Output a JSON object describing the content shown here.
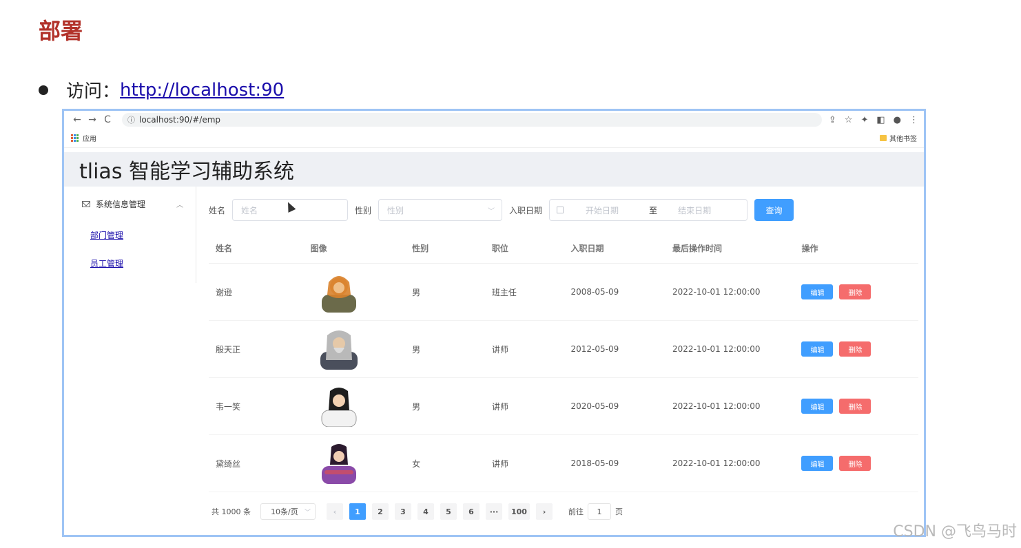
{
  "slide": {
    "title": "部署",
    "bullet_prefix": "访问：",
    "bullet_link": "http://localhost:90"
  },
  "browser": {
    "nav": {
      "back": "←",
      "forward": "→",
      "reload": "C"
    },
    "address": "localhost:90/#/emp",
    "bookmarks": {
      "apps_label": "应用",
      "other_label": "其他书签"
    }
  },
  "app": {
    "header_title": "tlias 智能学习辅助系统",
    "sidebar": {
      "group_label": "系统信息管理",
      "items": [
        {
          "label": "部门管理"
        },
        {
          "label": "员工管理"
        }
      ]
    },
    "filters": {
      "name_label": "姓名",
      "name_placeholder": "姓名",
      "gender_label": "性别",
      "gender_placeholder": "性别",
      "entry_label": "入职日期",
      "start_placeholder": "开始日期",
      "range_separator": "至",
      "end_placeholder": "结束日期",
      "search_button": "查询"
    },
    "table": {
      "columns": [
        "姓名",
        "图像",
        "性别",
        "职位",
        "入职日期",
        "最后操作时间",
        "操作"
      ],
      "rows": [
        {
          "name": "谢逊",
          "gender": "男",
          "job": "班主任",
          "entry_date": "2008-05-09",
          "update_time": "2022-10-01 12:00:00"
        },
        {
          "name": "殷天正",
          "gender": "男",
          "job": "讲师",
          "entry_date": "2012-05-09",
          "update_time": "2022-10-01 12:00:00"
        },
        {
          "name": "韦一笑",
          "gender": "男",
          "job": "讲师",
          "entry_date": "2020-05-09",
          "update_time": "2022-10-01 12:00:00"
        },
        {
          "name": "黛绮丝",
          "gender": "女",
          "job": "讲师",
          "entry_date": "2018-05-09",
          "update_time": "2022-10-01 12:00:00"
        }
      ],
      "edit_label": "编辑",
      "delete_label": "删除"
    },
    "pagination": {
      "total_text": "共 1000 条",
      "page_size": "10条/页",
      "pages": [
        "1",
        "2",
        "3",
        "4",
        "5",
        "6",
        "···",
        "100"
      ],
      "current_page": "1",
      "goto_prefix": "前往",
      "goto_value": "1",
      "goto_suffix": "页"
    }
  },
  "watermark": "CSDN @飞鸟马时"
}
